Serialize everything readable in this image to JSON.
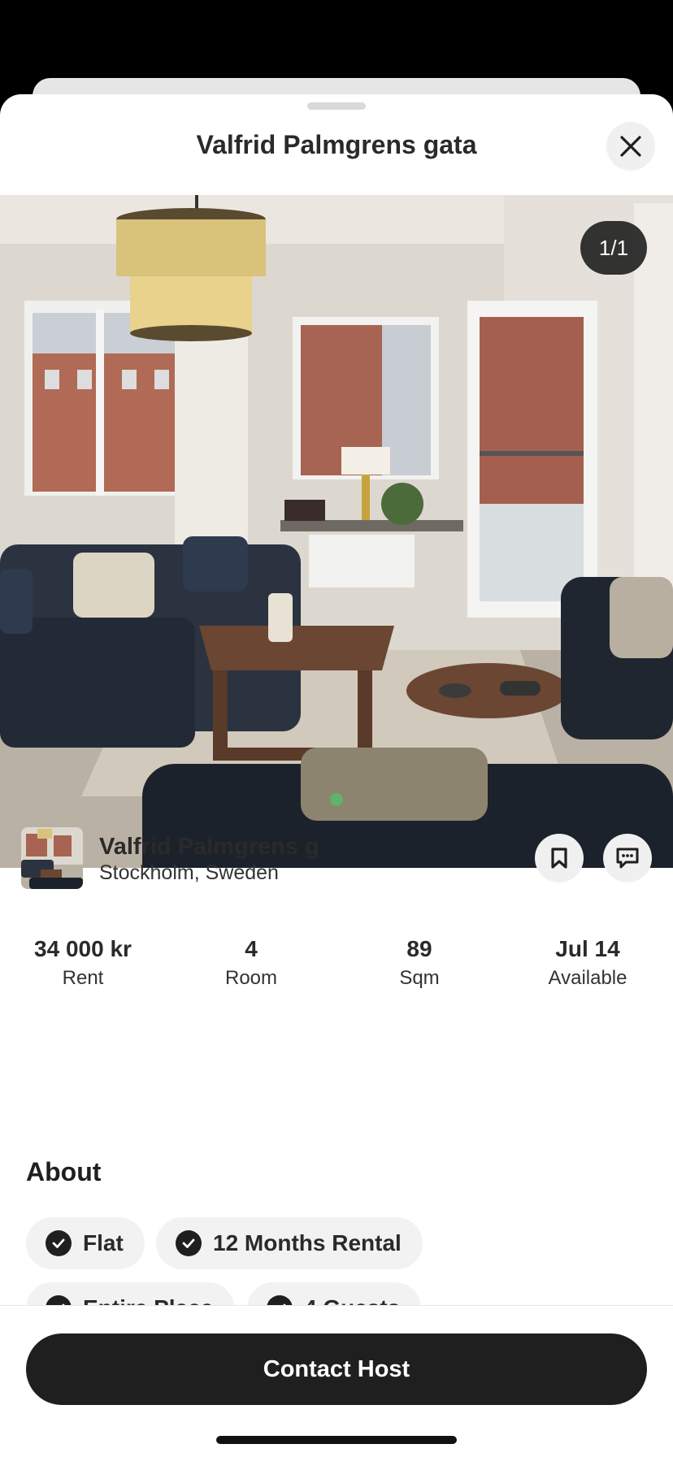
{
  "sheet": {
    "title": "Valfrid Palmgrens gata",
    "close_icon": "close-icon"
  },
  "gallery": {
    "counter": "1/1",
    "active_dot_color": "#5fb36b"
  },
  "listing": {
    "name": "Valfrid Palmgrens g",
    "location": "Stockholm, Sweden",
    "save_icon": "bookmark-icon",
    "message_icon": "chat-icon"
  },
  "stats": [
    {
      "value": "34 000 kr",
      "label": "Rent"
    },
    {
      "value": "4",
      "label": "Room"
    },
    {
      "value": "89",
      "label": "Sqm"
    },
    {
      "value": "Jul 14",
      "label": "Available"
    }
  ],
  "about": {
    "title": "About",
    "chips": [
      "Flat",
      "12 Months Rental",
      "Entire Place",
      "4 Guests"
    ]
  },
  "footer": {
    "contact_label": "Contact Host"
  }
}
